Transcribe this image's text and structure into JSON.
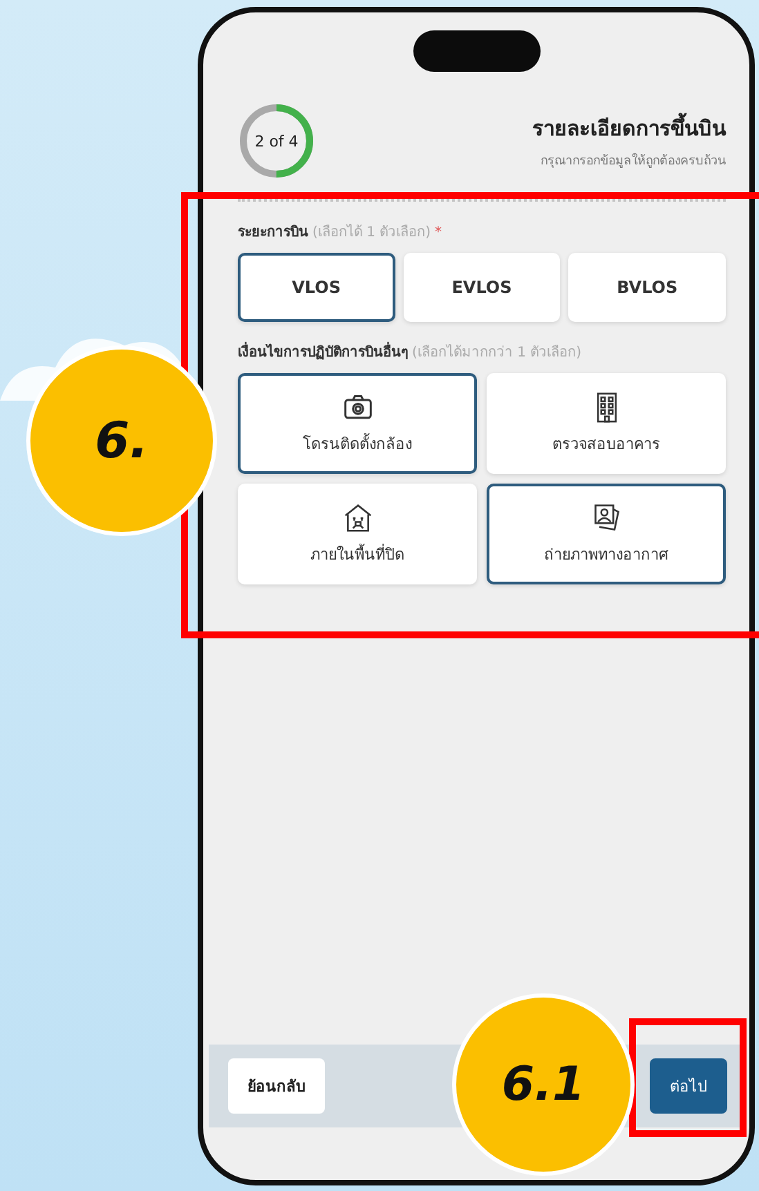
{
  "header": {
    "step": "2 of 4",
    "level": 0.5,
    "title": "รายละเอียดการขึ้นบิน",
    "subtitle": "กรุณากรอกข้อมูลให้ถูกต้องครบถ้วน"
  },
  "flight_range": {
    "label": "ระยะการบิน",
    "hint": "(เลือกได้ 1 ตัวเลือก)",
    "required_mark": "*",
    "options": [
      {
        "label": "VLOS",
        "selected": true
      },
      {
        "label": "EVLOS",
        "selected": false
      },
      {
        "label": "BVLOS",
        "selected": false
      }
    ]
  },
  "conditions": {
    "label": "เงื่อนไขการปฏิบัติการบินอื่นๆ",
    "hint": "(เลือกได้มากกว่า 1 ตัวเลือก)",
    "options": [
      {
        "kind": "camera",
        "label": "โดรนติดตั้งกล้อง",
        "selected": true
      },
      {
        "kind": "building",
        "label": "ตรวจสอบอาคาร",
        "selected": false
      },
      {
        "kind": "indoor",
        "label": "ภายในพื้นที่ปิด",
        "selected": false
      },
      {
        "kind": "photos",
        "label": "ถ่ายภาพทางอากาศ",
        "selected": true
      }
    ]
  },
  "footer": {
    "back": "ย้อนกลับ",
    "next": "ต่อไป"
  },
  "annotations": [
    {
      "label": "6."
    },
    {
      "label": "6.1"
    }
  ]
}
